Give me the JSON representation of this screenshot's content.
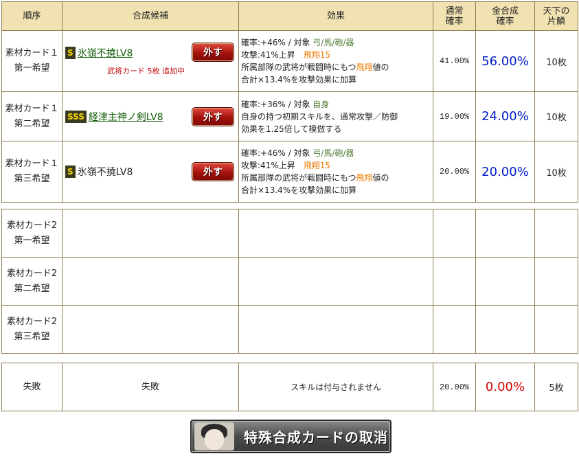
{
  "headers": {
    "seq": "順序",
    "candidate": "合成候補",
    "effect": "効果",
    "normal_rate": "通常\n確率",
    "gold_rate": "金合成\n確率",
    "fragment": "天下の\n片鱗"
  },
  "card1_rows": [
    {
      "seq_line1": "素材カード１",
      "seq_line2": "第一希望",
      "rank": "S",
      "skill": "氷嶺不撓LV8",
      "linked": true,
      "note": "武将カード 5枚 追加中",
      "remove_label": "外す",
      "effect": {
        "rate": "確率:+46%",
        "target_label": "対象",
        "target": "弓/馬/砲/器",
        "line2a": "攻撃:41%上昇",
        "line2b": "飛翔15",
        "line3a": "所属部隊の武将が戦闘時にもつ",
        "line3b": "飛翔",
        "line3c": "値の",
        "line4": "合計×13.4%を攻撃効果に加算"
      },
      "normal_rate": "41.00%",
      "gold_rate": "56.00%",
      "fragment": "10枚"
    },
    {
      "seq_line1": "素材カード１",
      "seq_line2": "第二希望",
      "rank": "SSS",
      "skill": "経津主神ノ剣LV8",
      "linked": true,
      "note": "",
      "remove_label": "外す",
      "effect": {
        "rate": "確率:+36%",
        "target_label": "対象",
        "target": "自身",
        "line2": "自身の持つ初期スキルを、通常攻撃／防御",
        "line3": "効果を1.25倍して模倣する"
      },
      "normal_rate": "19.00%",
      "gold_rate": "24.00%",
      "fragment": "10枚"
    },
    {
      "seq_line1": "素材カード１",
      "seq_line2": "第三希望",
      "rank": "S",
      "skill": "氷嶺不撓LV8",
      "linked": false,
      "note": "",
      "remove_label": "外す",
      "effect": {
        "rate": "確率:+46%",
        "target_label": "対象",
        "target": "弓/馬/砲/器",
        "line2a": "攻撃:41%上昇",
        "line2b": "飛翔15",
        "line3a": "所属部隊の武将が戦闘時にもつ",
        "line3b": "飛翔",
        "line3c": "値の",
        "line4": "合計×13.4%を攻撃効果に加算"
      },
      "normal_rate": "20.00%",
      "gold_rate": "20.00%",
      "fragment": "10枚"
    }
  ],
  "card2_rows": [
    {
      "seq_line1": "素材カード2",
      "seq_line2": "第一希望"
    },
    {
      "seq_line1": "素材カード2",
      "seq_line2": "第二希望"
    },
    {
      "seq_line1": "素材カード2",
      "seq_line2": "第三希望"
    }
  ],
  "failure": {
    "seq": "失敗",
    "candidate": "失敗",
    "effect": "スキルは付与されません",
    "normal_rate": "20.00%",
    "gold_rate": "0.00%",
    "fragment": "5枚"
  },
  "cancel_button": "特殊合成カードの取消",
  "colors": {
    "header_bg": "#f1e2b2",
    "border": "#8c7a4e",
    "gold_rate_blue": "#0018c8",
    "gold_rate_red": "#d40000",
    "skill_link": "#115a06",
    "orange_keyword": "#f07800",
    "green_target": "#4e7c36"
  }
}
